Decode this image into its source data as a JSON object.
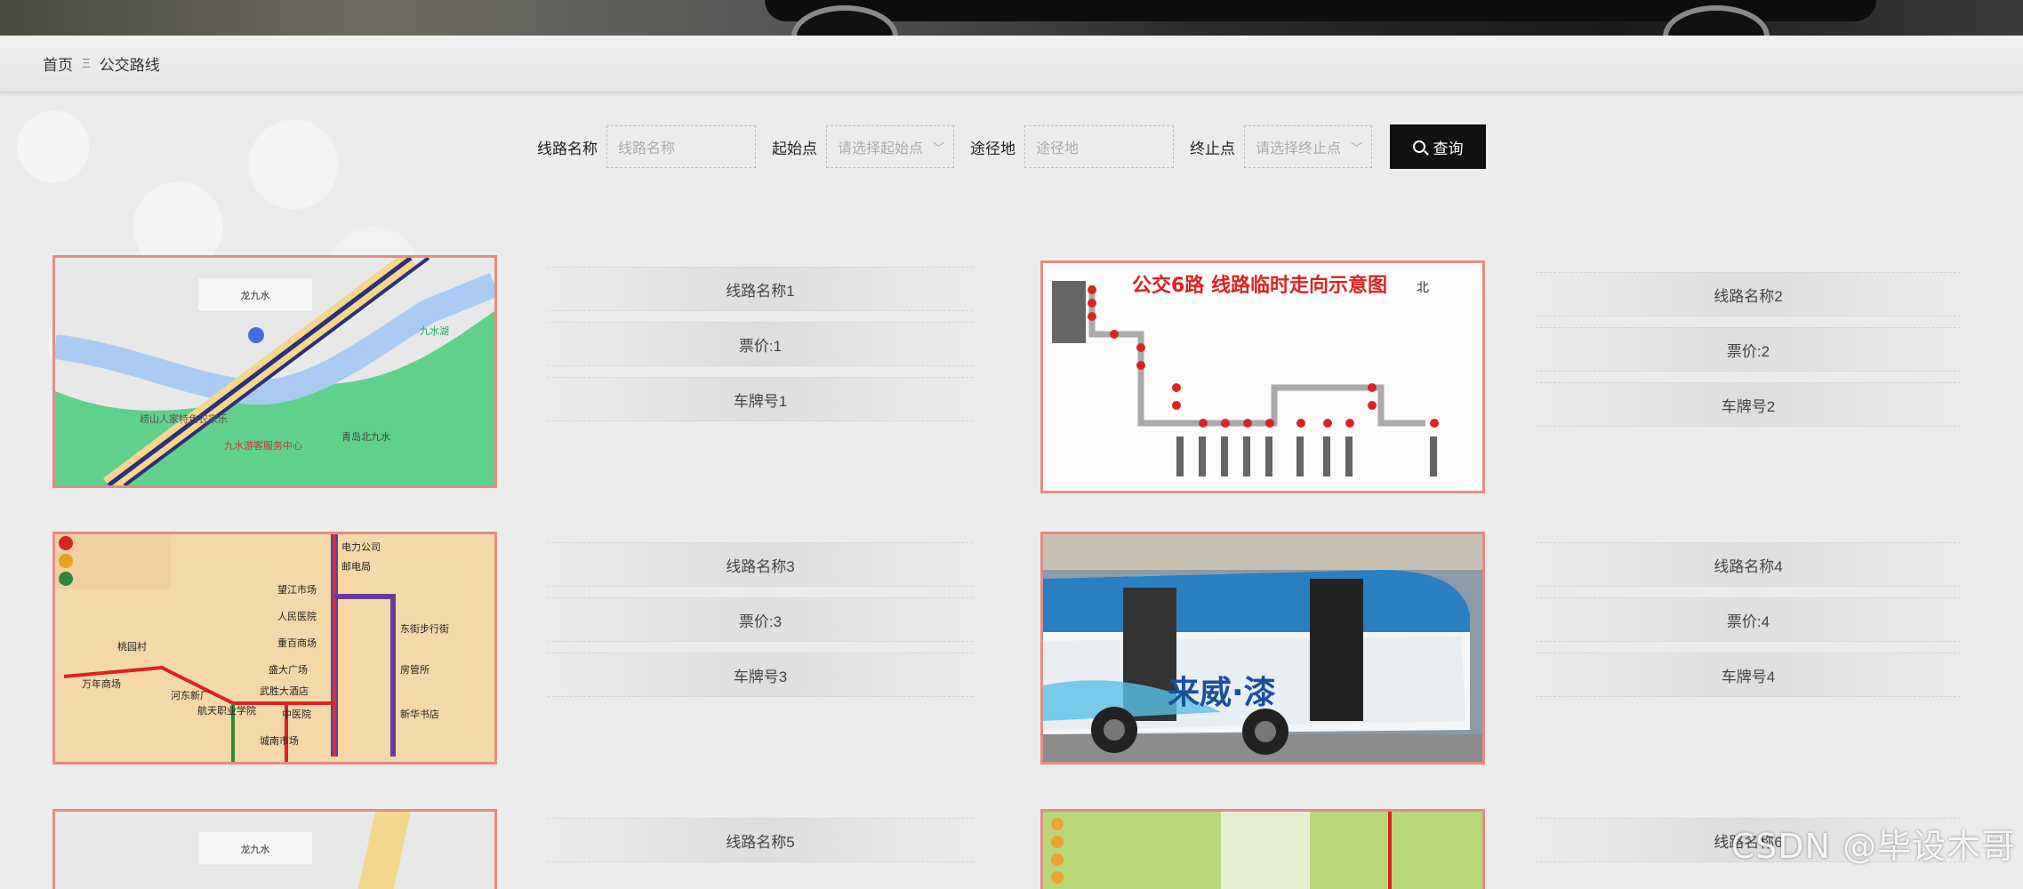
{
  "breadcrumb": {
    "home": "首页",
    "separator": "Ξ",
    "current": "公交路线"
  },
  "search": {
    "route_name_label": "线路名称",
    "route_name_placeholder": "线路名称",
    "start_label": "起始点",
    "start_placeholder": "请选择起始点",
    "via_label": "途径地",
    "via_placeholder": "途径地",
    "end_label": "终止点",
    "end_placeholder": "请选择终止点",
    "button_label": "查询",
    "button_icon": "search-icon"
  },
  "routes": [
    {
      "name": "线路名称1",
      "price": "票价:1",
      "plate": "车牌号1",
      "image": "map"
    },
    {
      "name": "线路名称2",
      "price": "票价:2",
      "plate": "车牌号2",
      "image": "route-diagram"
    },
    {
      "name": "线路名称3",
      "price": "票价:3",
      "plate": "车牌号3",
      "image": "line-map"
    },
    {
      "name": "线路名称4",
      "price": "票价:4",
      "plate": "车牌号4",
      "image": "bus-photo"
    },
    {
      "name": "线路名称5",
      "price": "",
      "plate": "",
      "image": "map"
    },
    {
      "name": "线路名称6",
      "price": "",
      "plate": "",
      "image": "line-map-green"
    }
  ],
  "images": {
    "map_labels": [
      "龙九水",
      "九水湖",
      "崂山人家特色农家乐",
      "青岛北九水",
      "九水游客服务中心"
    ],
    "route6_title": "公交6路 线路临时走向示意图",
    "route6_north": "北",
    "bus_text": "来威·漆",
    "linemap_stations": [
      "电力公司",
      "邮电局",
      "望江市场",
      "人民医院",
      "重百商场",
      "盛大广场",
      "东街步行街",
      "房管所",
      "新华书店",
      "中医院",
      "武胜大酒店",
      "城南市场",
      "万年商场",
      "桃园村",
      "河东新厂",
      "航天职业学院"
    ]
  },
  "watermark": "CSDN @毕设木哥",
  "colors": {
    "accent_border": "#e58c84",
    "button_bg": "#111111",
    "route_red": "#cc2222"
  }
}
